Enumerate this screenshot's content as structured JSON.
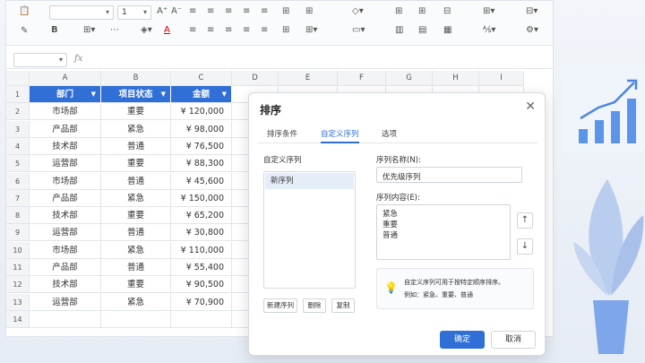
{
  "ribbon": {
    "font_size_value": "1",
    "increase_font_glyph": "A⁺",
    "decrease_font_glyph": "A⁻",
    "bold_label": "B"
  },
  "formula_bar": {
    "fx_label": "fx",
    "cell_ref": ""
  },
  "sheet": {
    "col_letters": [
      "A",
      "B",
      "C",
      "D",
      "E",
      "F",
      "G",
      "H",
      "I"
    ],
    "headers": [
      "部门",
      "项目状态",
      "金额"
    ],
    "rows": [
      {
        "n": "1"
      },
      {
        "n": "2",
        "dept": "市场部",
        "status": "重要",
        "amount": "¥ 120,000"
      },
      {
        "n": "3",
        "dept": "产品部",
        "status": "紧急",
        "amount": "¥ 98,000"
      },
      {
        "n": "4",
        "dept": "技术部",
        "status": "普通",
        "amount": "¥ 76,500"
      },
      {
        "n": "5",
        "dept": "运营部",
        "status": "重要",
        "amount": "¥ 88,300"
      },
      {
        "n": "6",
        "dept": "市场部",
        "status": "普通",
        "amount": "¥ 45,600"
      },
      {
        "n": "7",
        "dept": "产品部",
        "status": "紧急",
        "amount": "¥ 150,000"
      },
      {
        "n": "8",
        "dept": "技术部",
        "status": "重要",
        "amount": "¥ 65,200"
      },
      {
        "n": "9",
        "dept": "运营部",
        "status": "普通",
        "amount": "¥ 30,800"
      },
      {
        "n": "10",
        "dept": "市场部",
        "status": "紧急",
        "amount": "¥ 110,000"
      },
      {
        "n": "11",
        "dept": "产品部",
        "status": "普通",
        "amount": "¥ 55,400"
      },
      {
        "n": "12",
        "dept": "技术部",
        "status": "重要",
        "amount": "¥ 90,500"
      },
      {
        "n": "13",
        "dept": "运营部",
        "status": "紧急",
        "amount": "¥ 70,900"
      },
      {
        "n": "14"
      }
    ]
  },
  "dialog": {
    "title": "排序",
    "close_glyph": "✕",
    "tabs": [
      "排序条件",
      "自定义序列",
      "选项"
    ],
    "custom_list_label": "自定义序列",
    "list_items": [
      "新序列"
    ],
    "new_btn": "新建序列",
    "delete_btn": "删除",
    "copy_btn": "复制",
    "name_label": "序列名称(N):",
    "name_value": "优先级序列",
    "content_label": "序列内容(E):",
    "content_lines": [
      "紧急",
      "重要",
      "普通"
    ],
    "up_glyph": "↑",
    "down_glyph": "↓",
    "tip_line1": "自定义序列可用于按特定顺序排序。",
    "tip_line2": "例如：紧急、重要、普通",
    "ok": "确定",
    "cancel": "取消"
  },
  "colors": {
    "accent": "#2f6fd6",
    "header_bg": "#2f6fd6"
  }
}
